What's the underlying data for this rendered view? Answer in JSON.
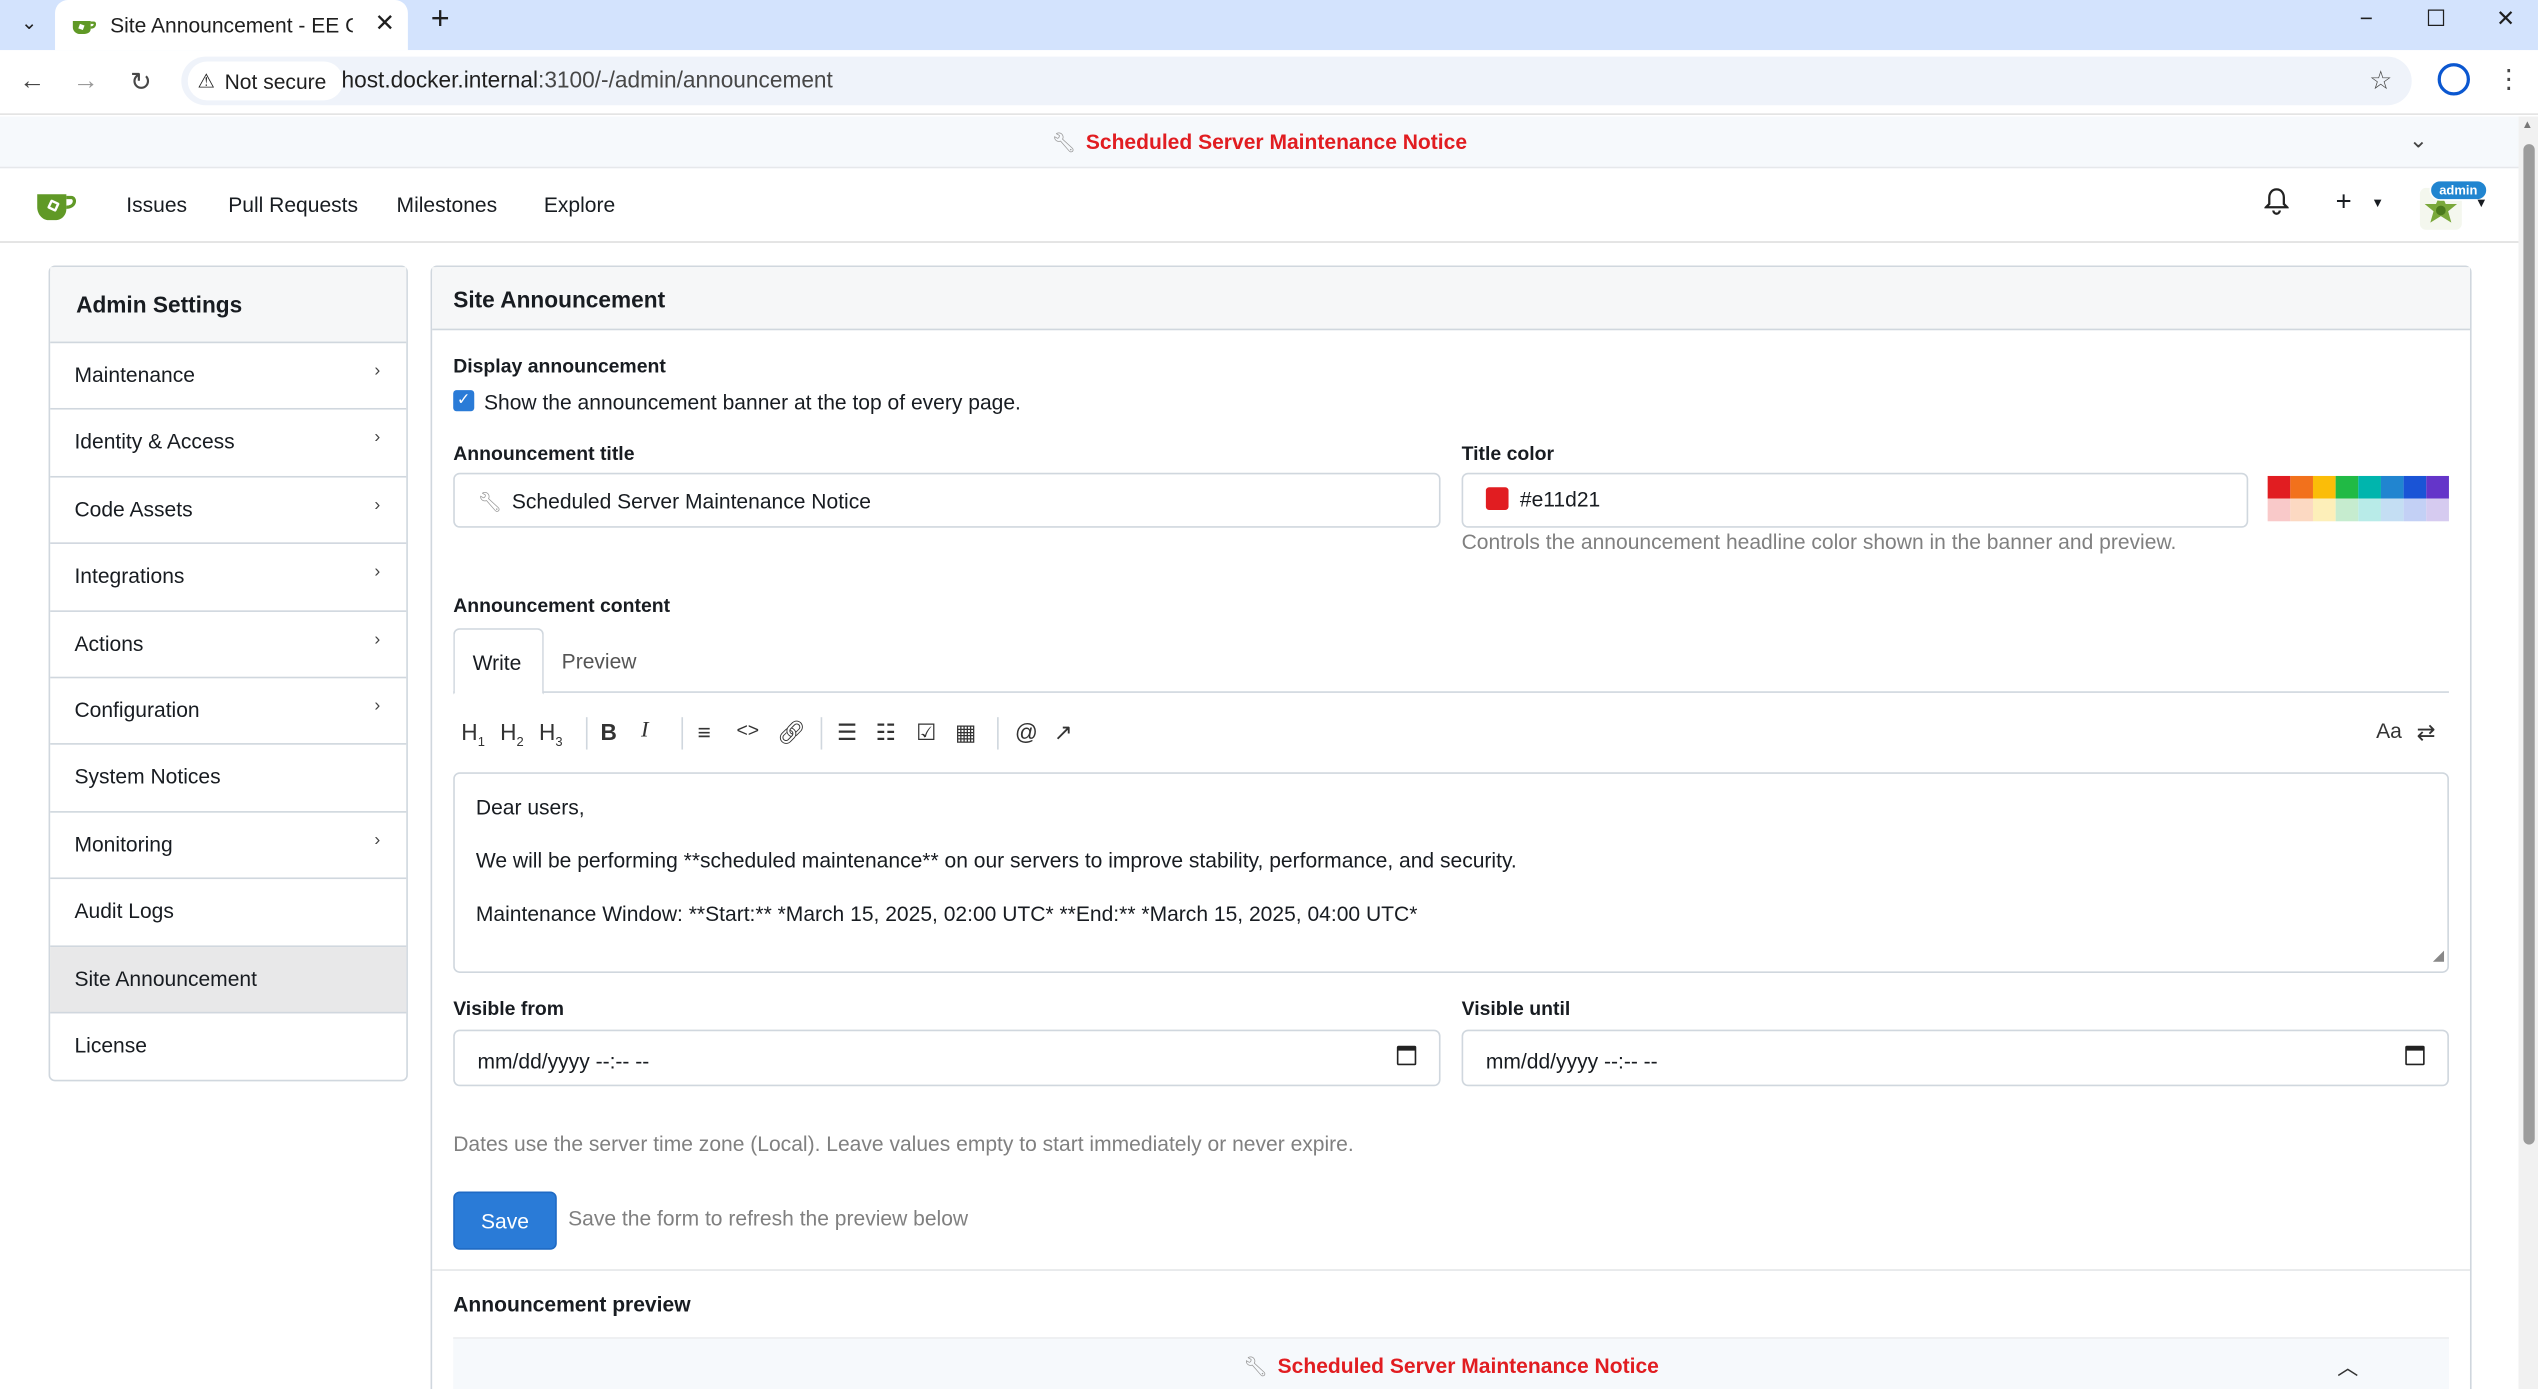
{
  "browser": {
    "tab_title": "Site Announcement - EE Gitea",
    "tab_close": "✕",
    "new_tab": "+",
    "not_secure": "Not secure",
    "url_host": "host.docker.internal",
    "url_path": ":3100/-/admin/announcement",
    "window_controls": [
      "−",
      "☐",
      "✕"
    ]
  },
  "banner": {
    "title": "Scheduled Server Maintenance Notice",
    "title_color": "#e11d21"
  },
  "nav": {
    "items": [
      "Issues",
      "Pull Requests",
      "Milestones",
      "Explore"
    ],
    "admin_badge": "admin"
  },
  "sidebar": {
    "header": "Admin Settings",
    "items": [
      {
        "label": "Maintenance",
        "arrow": "›"
      },
      {
        "label": "Identity & Access",
        "arrow": "›"
      },
      {
        "label": "Code Assets",
        "arrow": "›"
      },
      {
        "label": "Integrations",
        "arrow": "›"
      },
      {
        "label": "Actions",
        "arrow": "›"
      },
      {
        "label": "Configuration",
        "arrow": "›"
      },
      {
        "label": "System Notices",
        "arrow": ""
      },
      {
        "label": "Monitoring",
        "arrow": "›"
      },
      {
        "label": "Audit Logs",
        "arrow": ""
      },
      {
        "label": "Site Announcement",
        "arrow": "",
        "active": true
      },
      {
        "label": "License",
        "arrow": ""
      }
    ]
  },
  "form": {
    "heading": "Site Announcement",
    "display_label": "Display announcement",
    "display_checkbox_text": "Show the announcement banner at the top of every page.",
    "display_checked": true,
    "title_label": "Announcement title",
    "title_value": "Scheduled Server Maintenance Notice",
    "color_label": "Title color",
    "color_value": "#e11d21",
    "color_help": "Controls the announcement headline color shown in the banner and preview.",
    "palette": [
      "#e11d21",
      "#f2711c",
      "#fbbd08",
      "#21ba45",
      "#00b5ad",
      "#2185d0",
      "#1a54d6",
      "#6435c9",
      "#f9c9c9",
      "#fcd9c2",
      "#fdefb9",
      "#c6eccf",
      "#b8ebe8",
      "#c4def3",
      "#c3d0f5",
      "#d6cbf0"
    ],
    "content_label": "Announcement content",
    "tab_write": "Write",
    "tab_preview": "Preview",
    "content_lines": [
      "Dear users,",
      "We will be performing **scheduled maintenance** on our servers to improve stability, performance, and security.",
      "Maintenance Window: **Start:** *March 15, 2025, 02:00 UTC* **End:** *March 15, 2025, 04:00 UTC*"
    ],
    "visible_from_label": "Visible from",
    "visible_until_label": "Visible until",
    "date_placeholder": "mm/dd/yyyy --:-- --",
    "date_help": "Dates use the server time zone (Local). Leave values empty to start immediately or never expire.",
    "save_label": "Save",
    "save_hint": "Save the form to refresh the preview below",
    "preview_label": "Announcement preview"
  }
}
